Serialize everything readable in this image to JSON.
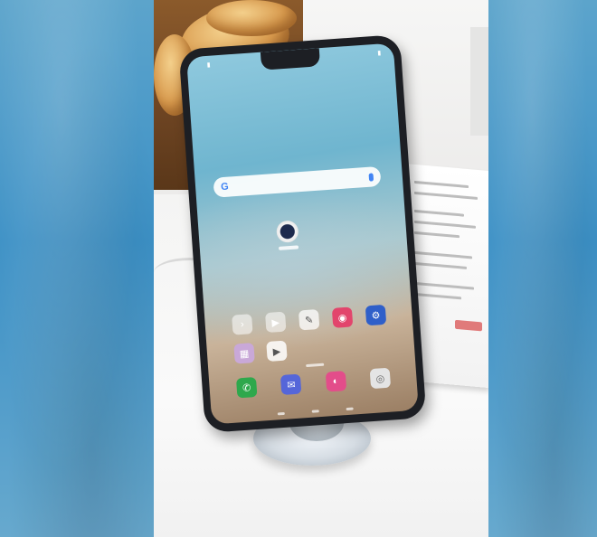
{
  "scene": {
    "device": "smartphone on display stand",
    "colors": {
      "side_blur": "#4a97c6",
      "phone_body": "#1d1f24",
      "wallpaper_top": "#8fc9de",
      "wallpaper_bottom": "#9b7f64",
      "accent_google": "#4285f4"
    }
  },
  "screen": {
    "search": {
      "logo_text": "G",
      "icon": "mic-icon"
    },
    "widget": {
      "icon": "clock-icon"
    },
    "row1": [
      {
        "icon": "chevron-icon",
        "glyph": "›",
        "color": "#ffffff"
      },
      {
        "icon": "play-store-icon",
        "glyph": "▶",
        "color": "#ffffff"
      },
      {
        "icon": "pen-icon",
        "glyph": "✎",
        "color": "#ffffff"
      },
      {
        "icon": "camera-icon",
        "glyph": "◉",
        "color": "#e2456c"
      },
      {
        "icon": "settings-icon",
        "glyph": "⚙",
        "color": "#2f5fc9"
      }
    ],
    "row2": [
      {
        "icon": "folder-icon",
        "glyph": "▦",
        "color": "#c9a8d8"
      },
      {
        "icon": "gallery-icon",
        "glyph": "▶",
        "color": "#e8e8e8"
      }
    ],
    "dock": [
      {
        "icon": "phone-icon",
        "glyph": "✆",
        "color": "#2ea84c"
      },
      {
        "icon": "messages-icon",
        "glyph": "✉",
        "color": "#5566d9"
      },
      {
        "icon": "browser-icon",
        "glyph": "◐",
        "color": "#e34d8a"
      },
      {
        "icon": "camera-icon",
        "glyph": "◎",
        "color": "#e4e4e4"
      }
    ]
  }
}
